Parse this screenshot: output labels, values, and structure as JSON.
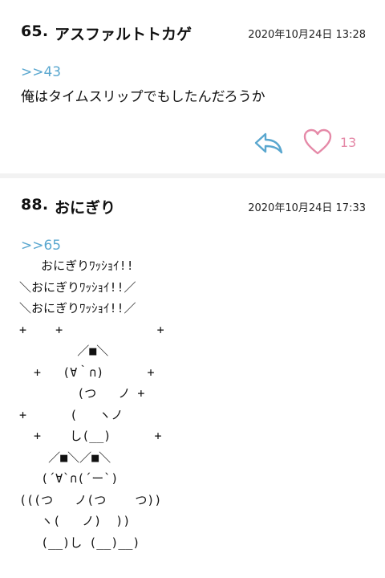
{
  "posts": [
    {
      "number": "65.",
      "name": "アスファルトトカゲ",
      "date": "2020年10月24日 13:28",
      "anchor": ">>43",
      "body": "俺はタイムスリップでもしたんだろうか",
      "likes": "13"
    },
    {
      "number": "88.",
      "name": "おにぎり",
      "date": "2020年10月24日 17:33",
      "anchor": ">>65",
      "ascii_art": "   おにぎりﾜｯｼｮｲ!!\n＼おにぎりﾜｯｼｮｲ!!／\n＼おにぎりﾜｯｼｮｲ!!／\n+    +             +\n        ／■＼\n  +   (∀｀∩)      +\n        (つ   ノ +\n+      (   ヽノ\n  +    し(__)      +\n    ／■＼／■＼\n   (´∀`∩(´ー`)\n(((つ   ノ(つ    つ))\n   ヽ(   ノ)  ))\n   (__)し (__)__)"
    }
  ],
  "icons": {
    "reply": "reply-arrow-icon",
    "like": "heart-icon"
  },
  "colors": {
    "anchor": "#5aa7cf",
    "reply_icon": "#5aa7cf",
    "heart_icon": "#e58aa8",
    "background": "#f2f2f2"
  }
}
